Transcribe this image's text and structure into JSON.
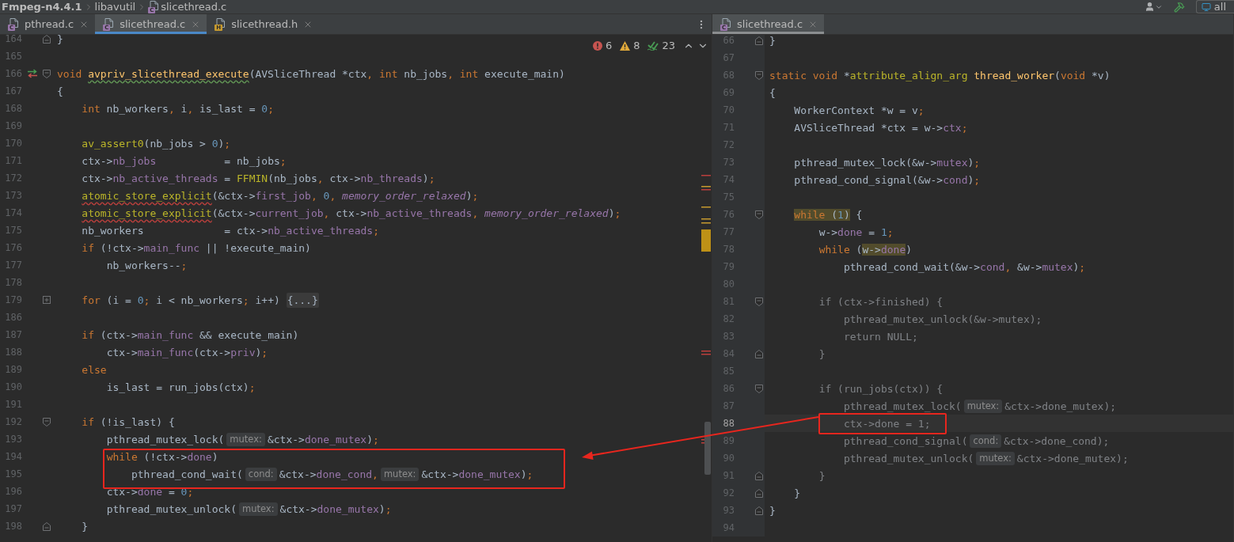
{
  "breadcrumb": [
    {
      "label": "Fmpeg-n4.4.1",
      "kind": "project"
    },
    {
      "label": "libavutil",
      "kind": "folder"
    },
    {
      "label": "slicethread.c",
      "kind": "file",
      "badge": "C"
    }
  ],
  "toolbar": {
    "config_label": "all"
  },
  "left_pane": {
    "focused": true,
    "tabs": [
      {
        "label": "pthread.c",
        "kind": "c",
        "badge": "C",
        "selected": false
      },
      {
        "label": "slicethread.c",
        "kind": "c",
        "badge": "C",
        "selected": true
      },
      {
        "label": "slicethread.h",
        "kind": "h",
        "badge": "H",
        "selected": false
      }
    ],
    "inspections": {
      "errors": "6",
      "warnings": "8",
      "typos": "23"
    },
    "lines": [
      {
        "number": "164",
        "current": false,
        "fold": {
          "kind": "end"
        },
        "tokens": [
          {
            "kind": "plain",
            "text": "}"
          }
        ]
      },
      {
        "number": "165",
        "current": false
      },
      {
        "number": "166",
        "current": false,
        "fold": {
          "kind": "start"
        },
        "marker": {
          "kind": "navigate"
        },
        "tokens": [
          {
            "kind": "kw",
            "text": "void "
          },
          {
            "kind": "fn-wavy",
            "text": "avpriv_slicethread_execute"
          },
          {
            "kind": "plain",
            "text": "(AVSliceThread *ctx"
          },
          {
            "kind": "punct",
            "text": ", "
          },
          {
            "kind": "kw",
            "text": "int"
          },
          {
            "kind": "plain",
            "text": " nb_jobs"
          },
          {
            "kind": "punct",
            "text": ", "
          },
          {
            "kind": "kw",
            "text": "int"
          },
          {
            "kind": "plain",
            "text": " execute_main)"
          }
        ]
      },
      {
        "number": "167",
        "current": false,
        "tokens": [
          {
            "kind": "plain",
            "text": "{"
          }
        ]
      },
      {
        "number": "168",
        "current": false,
        "tokens": [
          {
            "kind": "kw",
            "text": "    int"
          },
          {
            "kind": "plain",
            "text": " nb_workers"
          },
          {
            "kind": "punct",
            "text": ","
          },
          {
            "kind": "plain",
            "text": " i"
          },
          {
            "kind": "punct",
            "text": ","
          },
          {
            "kind": "plain",
            "text": " is_last = "
          },
          {
            "kind": "num",
            "text": "0"
          },
          {
            "kind": "punct",
            "text": ";"
          }
        ]
      },
      {
        "number": "169",
        "current": false
      },
      {
        "number": "170",
        "current": false,
        "tokens": [
          {
            "kind": "call",
            "text": "    av_assert0"
          },
          {
            "kind": "plain",
            "text": "(nb_jobs > "
          },
          {
            "kind": "num",
            "text": "0"
          },
          {
            "kind": "plain",
            "text": ")"
          },
          {
            "kind": "punct",
            "text": ";"
          }
        ]
      },
      {
        "number": "171",
        "current": false,
        "tokens": [
          {
            "kind": "plain",
            "text": "    ctx->"
          },
          {
            "kind": "field",
            "text": "nb_jobs"
          },
          {
            "kind": "plain",
            "text": "           = nb_jobs"
          },
          {
            "kind": "punct",
            "text": ";"
          }
        ]
      },
      {
        "number": "172",
        "current": false,
        "tokens": [
          {
            "kind": "plain",
            "text": "    ctx->"
          },
          {
            "kind": "field",
            "text": "nb_active_threads"
          },
          {
            "kind": "plain",
            "text": " = "
          },
          {
            "kind": "call",
            "text": "FFMIN"
          },
          {
            "kind": "plain",
            "text": "(nb_jobs"
          },
          {
            "kind": "punct",
            "text": ","
          },
          {
            "kind": "plain",
            "text": " ctx->"
          },
          {
            "kind": "field",
            "text": "nb_threads"
          },
          {
            "kind": "plain",
            "text": ")"
          },
          {
            "kind": "punct",
            "text": ";"
          }
        ]
      },
      {
        "number": "173",
        "current": false,
        "tokens": [
          {
            "kind": "call-wavy",
            "text": "    atomic_store_explicit"
          },
          {
            "kind": "plain",
            "text": "(&ctx->"
          },
          {
            "kind": "field",
            "text": "first_job"
          },
          {
            "kind": "punct",
            "text": ", "
          },
          {
            "kind": "num",
            "text": "0"
          },
          {
            "kind": "punct",
            "text": ", "
          },
          {
            "kind": "italic",
            "text": "memory_order_relaxed"
          },
          {
            "kind": "plain",
            "text": ")"
          },
          {
            "kind": "punct",
            "text": ";"
          }
        ]
      },
      {
        "number": "174",
        "current": false,
        "tokens": [
          {
            "kind": "call-wavy",
            "text": "    atomic_store_explicit"
          },
          {
            "kind": "plain",
            "text": "(&ctx->"
          },
          {
            "kind": "field",
            "text": "current_job"
          },
          {
            "kind": "punct",
            "text": ","
          },
          {
            "kind": "plain",
            "text": " ctx->"
          },
          {
            "kind": "field",
            "text": "nb_active_threads"
          },
          {
            "kind": "punct",
            "text": ", "
          },
          {
            "kind": "italic",
            "text": "memory_order_relaxed"
          },
          {
            "kind": "plain",
            "text": ")"
          },
          {
            "kind": "punct",
            "text": ";"
          }
        ]
      },
      {
        "number": "175",
        "current": false,
        "tokens": [
          {
            "kind": "plain",
            "text": "    nb_workers             = ctx->"
          },
          {
            "kind": "field",
            "text": "nb_active_threads"
          },
          {
            "kind": "punct",
            "text": ";"
          }
        ]
      },
      {
        "number": "176",
        "current": false,
        "tokens": [
          {
            "kind": "kw",
            "text": "    if"
          },
          {
            "kind": "plain",
            "text": " (!ctx->"
          },
          {
            "kind": "field",
            "text": "main_func"
          },
          {
            "kind": "plain",
            "text": " || !execute_main)"
          }
        ]
      },
      {
        "number": "177",
        "current": false,
        "tokens": [
          {
            "kind": "plain",
            "text": "        nb_workers--"
          },
          {
            "kind": "punct",
            "text": ";"
          }
        ]
      },
      {
        "number": "178",
        "current": false
      },
      {
        "number": "179",
        "current": false,
        "fold": {
          "kind": "collapsed"
        },
        "tokens": [
          {
            "kind": "kw",
            "text": "    for"
          },
          {
            "kind": "plain",
            "text": " (i = "
          },
          {
            "kind": "num",
            "text": "0"
          },
          {
            "kind": "punct",
            "text": ";"
          },
          {
            "kind": "plain",
            "text": " i < nb_workers"
          },
          {
            "kind": "punct",
            "text": ";"
          },
          {
            "kind": "plain",
            "text": " i++) "
          },
          {
            "kind": "fold",
            "text": "{...}"
          }
        ]
      },
      {
        "number": "186",
        "current": false
      },
      {
        "number": "187",
        "current": false,
        "tokens": [
          {
            "kind": "kw",
            "text": "    if"
          },
          {
            "kind": "plain",
            "text": " (ctx->"
          },
          {
            "kind": "field",
            "text": "main_func"
          },
          {
            "kind": "plain",
            "text": " && execute_main)"
          }
        ]
      },
      {
        "number": "188",
        "current": false,
        "tokens": [
          {
            "kind": "plain",
            "text": "        ctx->"
          },
          {
            "kind": "field",
            "text": "main_func"
          },
          {
            "kind": "plain",
            "text": "(ctx->"
          },
          {
            "kind": "field",
            "text": "priv"
          },
          {
            "kind": "plain",
            "text": ")"
          },
          {
            "kind": "punct",
            "text": ";"
          }
        ]
      },
      {
        "number": "189",
        "current": false,
        "tokens": [
          {
            "kind": "kw",
            "text": "    else"
          }
        ]
      },
      {
        "number": "190",
        "current": false,
        "tokens": [
          {
            "kind": "plain",
            "text": "        is_last = run_jobs(ctx)"
          },
          {
            "kind": "punct",
            "text": ";"
          }
        ]
      },
      {
        "number": "191",
        "current": false
      },
      {
        "number": "192",
        "current": false,
        "fold": {
          "kind": "start"
        },
        "tokens": [
          {
            "kind": "kw",
            "text": "    if"
          },
          {
            "kind": "plain",
            "text": " (!is_last) {"
          }
        ]
      },
      {
        "number": "193",
        "current": false,
        "tokens": [
          {
            "kind": "plain",
            "text": "        pthread_mutex_lock("
          },
          {
            "kind": "hint",
            "text": "mutex:"
          },
          {
            "kind": "plain",
            "text": "&ctx->"
          },
          {
            "kind": "field",
            "text": "done_mutex"
          },
          {
            "kind": "plain",
            "text": ")"
          },
          {
            "kind": "punct",
            "text": ";"
          }
        ]
      },
      {
        "number": "194",
        "current": false,
        "tokens": [
          {
            "kind": "kw",
            "text": "        while"
          },
          {
            "kind": "plain",
            "text": " (!ctx->"
          },
          {
            "kind": "field",
            "text": "done"
          },
          {
            "kind": "plain",
            "text": ")"
          }
        ]
      },
      {
        "number": "195",
        "current": false,
        "tokens": [
          {
            "kind": "plain",
            "text": "            pthread_cond_wait("
          },
          {
            "kind": "hint",
            "text": "cond:"
          },
          {
            "kind": "plain",
            "text": "&ctx->"
          },
          {
            "kind": "field",
            "text": "done_cond"
          },
          {
            "kind": "punct",
            "text": ","
          },
          {
            "kind": "hint",
            "text": "mutex:"
          },
          {
            "kind": "plain",
            "text": "&ctx->"
          },
          {
            "kind": "field",
            "text": "done_mutex"
          },
          {
            "kind": "plain",
            "text": ")"
          },
          {
            "kind": "punct",
            "text": ";"
          }
        ]
      },
      {
        "number": "196",
        "current": false,
        "tokens": [
          {
            "kind": "plain",
            "text": "        ctx->"
          },
          {
            "kind": "field",
            "text": "done"
          },
          {
            "kind": "plain",
            "text": " = "
          },
          {
            "kind": "num",
            "text": "0"
          },
          {
            "kind": "punct",
            "text": ";"
          }
        ]
      },
      {
        "number": "197",
        "current": false,
        "tokens": [
          {
            "kind": "plain",
            "text": "        pthread_mutex_unlock("
          },
          {
            "kind": "hint",
            "text": "mutex:"
          },
          {
            "kind": "plain",
            "text": "&ctx->"
          },
          {
            "kind": "field",
            "text": "done_mutex"
          },
          {
            "kind": "plain",
            "text": ")"
          },
          {
            "kind": "punct",
            "text": ";"
          }
        ]
      },
      {
        "number": "198",
        "current": false,
        "fold": {
          "kind": "end"
        },
        "tokens": [
          {
            "kind": "plain",
            "text": "    }"
          }
        ]
      }
    ]
  },
  "right_pane": {
    "focused": false,
    "tabs": [
      {
        "label": "slicethread.c",
        "kind": "c",
        "badge": "C",
        "selected": true
      }
    ],
    "lines": [
      {
        "number": "66",
        "current": false,
        "fold": {
          "kind": "end"
        },
        "tokens": [
          {
            "kind": "plain",
            "text": "}"
          }
        ]
      },
      {
        "number": "67",
        "current": false
      },
      {
        "number": "68",
        "current": false,
        "fold": {
          "kind": "start"
        },
        "tokens": [
          {
            "kind": "kw",
            "text": "static void"
          },
          {
            "kind": "plain",
            "text": " *"
          },
          {
            "kind": "call",
            "text": "attribute_align_arg "
          },
          {
            "kind": "fn",
            "text": "thread_worker"
          },
          {
            "kind": "plain",
            "text": "("
          },
          {
            "kind": "kw",
            "text": "void"
          },
          {
            "kind": "plain",
            "text": " *v)"
          }
        ]
      },
      {
        "number": "69",
        "current": false,
        "tokens": [
          {
            "kind": "plain",
            "text": "{"
          }
        ]
      },
      {
        "number": "70",
        "current": false,
        "tokens": [
          {
            "kind": "plain",
            "text": "    WorkerContext *w = v"
          },
          {
            "kind": "punct",
            "text": ";"
          }
        ]
      },
      {
        "number": "71",
        "current": false,
        "tokens": [
          {
            "kind": "plain",
            "text": "    AVSliceThread *ctx = w->"
          },
          {
            "kind": "field",
            "text": "ctx"
          },
          {
            "kind": "punct",
            "text": ";"
          }
        ]
      },
      {
        "number": "72",
        "current": false
      },
      {
        "number": "73",
        "current": false,
        "tokens": [
          {
            "kind": "plain",
            "text": "    pthread_mutex_lock(&w->"
          },
          {
            "kind": "field",
            "text": "mutex"
          },
          {
            "kind": "plain",
            "text": ")"
          },
          {
            "kind": "punct",
            "text": ";"
          }
        ]
      },
      {
        "number": "74",
        "current": false,
        "tokens": [
          {
            "kind": "plain",
            "text": "    pthread_cond_signal(&w->"
          },
          {
            "kind": "field",
            "text": "cond"
          },
          {
            "kind": "plain",
            "text": ")"
          },
          {
            "kind": "punct",
            "text": ";"
          }
        ]
      },
      {
        "number": "75",
        "current": false
      },
      {
        "number": "76",
        "current": false,
        "fold": {
          "kind": "start"
        },
        "tokens": [
          {
            "kind": "kw-hl",
            "text": "    while"
          },
          {
            "kind": "plain-hl",
            "text": " ("
          },
          {
            "kind": "num-hl",
            "text": "1"
          },
          {
            "kind": "plain-hl",
            "text": ")"
          },
          {
            "kind": "plain",
            "text": " {"
          }
        ]
      },
      {
        "number": "77",
        "current": false,
        "tokens": [
          {
            "kind": "plain",
            "text": "        w->"
          },
          {
            "kind": "field",
            "text": "done"
          },
          {
            "kind": "plain",
            "text": " = "
          },
          {
            "kind": "num",
            "text": "1"
          },
          {
            "kind": "punct",
            "text": ";"
          }
        ]
      },
      {
        "number": "78",
        "current": false,
        "tokens": [
          {
            "kind": "kw",
            "text": "        while"
          },
          {
            "kind": "plain",
            "text": " ("
          },
          {
            "kind": "plain-hl",
            "text": "w->"
          },
          {
            "kind": "field-hl",
            "text": "done"
          },
          {
            "kind": "plain",
            "text": ")"
          }
        ]
      },
      {
        "number": "79",
        "current": false,
        "tokens": [
          {
            "kind": "plain",
            "text": "            pthread_cond_wait(&w->"
          },
          {
            "kind": "field",
            "text": "cond"
          },
          {
            "kind": "punct",
            "text": ","
          },
          {
            "kind": "plain",
            "text": " &w->"
          },
          {
            "kind": "field",
            "text": "mutex"
          },
          {
            "kind": "plain",
            "text": ")"
          },
          {
            "kind": "punct",
            "text": ";"
          }
        ]
      },
      {
        "number": "80",
        "current": false
      },
      {
        "number": "81",
        "current": false,
        "fold": {
          "kind": "start"
        },
        "tokens": [
          {
            "kind": "dim",
            "text": "        if (ctx->finished) {"
          }
        ]
      },
      {
        "number": "82",
        "current": false,
        "tokens": [
          {
            "kind": "dim",
            "text": "            pthread_mutex_unlock(&w->mutex);"
          }
        ]
      },
      {
        "number": "83",
        "current": false,
        "tokens": [
          {
            "kind": "dim",
            "text": "            return NULL;"
          }
        ]
      },
      {
        "number": "84",
        "current": false,
        "fold": {
          "kind": "end"
        },
        "tokens": [
          {
            "kind": "dim",
            "text": "        }"
          }
        ]
      },
      {
        "number": "85",
        "current": false
      },
      {
        "number": "86",
        "current": false,
        "fold": {
          "kind": "start"
        },
        "tokens": [
          {
            "kind": "dim",
            "text": "        if (run_jobs(ctx)) {"
          }
        ]
      },
      {
        "number": "87",
        "current": false,
        "tokens": [
          {
            "kind": "dim",
            "text": "            pthread_mutex_lock("
          },
          {
            "kind": "hint",
            "text": "mutex:"
          },
          {
            "kind": "dim",
            "text": "&ctx->done_mutex);"
          }
        ]
      },
      {
        "number": "88",
        "current": true,
        "tokens": [
          {
            "kind": "dim",
            "text": "            ctx->done = 1;"
          }
        ]
      },
      {
        "number": "89",
        "current": false,
        "tokens": [
          {
            "kind": "dim",
            "text": "            pthread_cond_signal("
          },
          {
            "kind": "hint",
            "text": "cond:"
          },
          {
            "kind": "dim",
            "text": "&ctx->done_cond);"
          }
        ]
      },
      {
        "number": "90",
        "current": false,
        "tokens": [
          {
            "kind": "dim",
            "text": "            pthread_mutex_unlock("
          },
          {
            "kind": "hint",
            "text": "mutex:"
          },
          {
            "kind": "dim",
            "text": "&ctx->done_mutex);"
          }
        ]
      },
      {
        "number": "91",
        "current": false,
        "fold": {
          "kind": "end"
        },
        "tokens": [
          {
            "kind": "dim",
            "text": "        }"
          }
        ]
      },
      {
        "number": "92",
        "current": false,
        "fold": {
          "kind": "end"
        },
        "tokens": [
          {
            "kind": "plain",
            "text": "    }"
          }
        ]
      },
      {
        "number": "93",
        "current": false,
        "fold": {
          "kind": "end"
        },
        "tokens": [
          {
            "kind": "plain",
            "text": "}"
          }
        ]
      },
      {
        "number": "94",
        "current": false
      }
    ]
  }
}
